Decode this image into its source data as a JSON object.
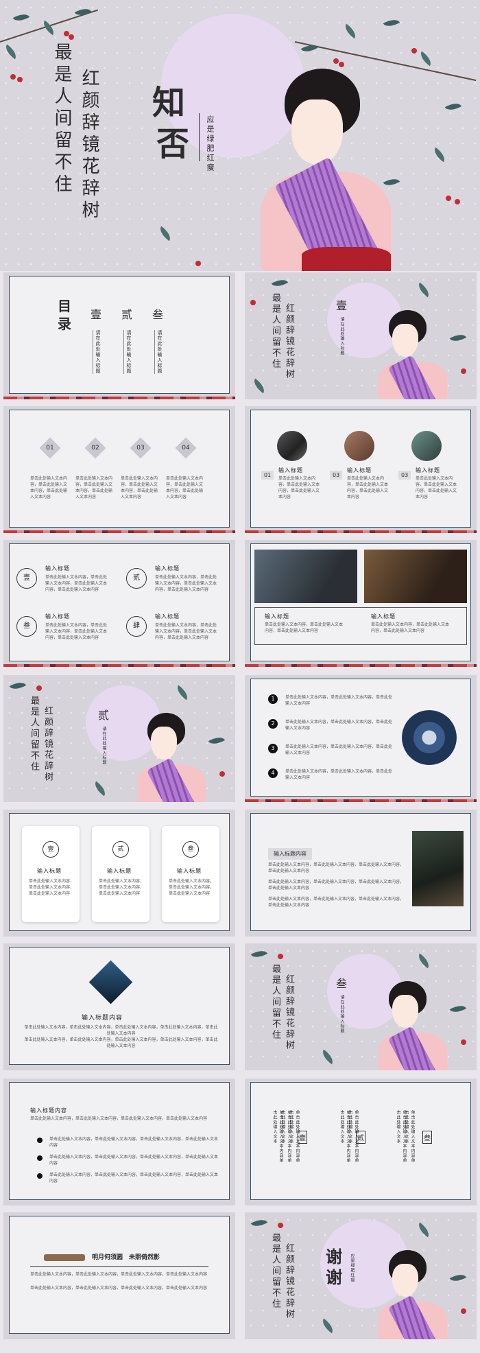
{
  "hero": {
    "title_1": "知",
    "title_2": "否",
    "subtitle": "应是绿肥红瘦",
    "poem_left": "最是人间留不住",
    "poem_right": "红颜辞镜花辞树"
  },
  "toc": {
    "title": "目录",
    "items": [
      {
        "num": "壹",
        "desc": "请在此处输入标题"
      },
      {
        "num": "贰",
        "desc": "请在此处输入标题"
      },
      {
        "num": "叁",
        "desc": "请在此处输入标题"
      }
    ]
  },
  "section1": {
    "num": "壹",
    "desc": "请在此处输入标题"
  },
  "section2": {
    "num": "贰",
    "desc": "请在此处输入标题"
  },
  "section3": {
    "num": "叁",
    "desc": "请在此处输入标题"
  },
  "numbers_slide": {
    "items": [
      "01",
      "02",
      "03",
      "04"
    ],
    "text": "单击此处输入文本内容，单击此处输入文本内容，单击此处输入文本内容"
  },
  "photo_circles": {
    "items": [
      {
        "num": "01",
        "title": "输入标题"
      },
      {
        "num": "03",
        "title": "输入标题"
      },
      {
        "num": "03",
        "title": "输入标题"
      }
    ],
    "text": "单击此处输入文本内容，单击此处输入文本内容，单击此处输入文本内容"
  },
  "four_circles": {
    "items": [
      {
        "num": "壹",
        "title": "输入标题"
      },
      {
        "num": "贰",
        "title": "输入标题"
      },
      {
        "num": "叁",
        "title": "输入标题"
      },
      {
        "num": "肆",
        "title": "输入标题"
      }
    ],
    "text": "单击此处输入文本内容，单击此处输入文本内容，单击此处输入文本内容，单击此处输入文本内容"
  },
  "two_photos": {
    "titles": [
      "输入标题",
      "输入标题"
    ],
    "text": "单击此处输入文本内容，单击此处输入文本内容，单击此处输入文本内容"
  },
  "list_slide": {
    "items": [
      "1",
      "2",
      "3",
      "4"
    ],
    "text": "单击此处输入文本内容，单击此处输入文本内容，单击此处输入文本内容"
  },
  "white_cards": {
    "items": [
      {
        "num": "壹",
        "title": "输入标题"
      },
      {
        "num": "贰",
        "title": "输入标题"
      },
      {
        "num": "叁",
        "title": "输入标题"
      }
    ],
    "text": "单击此处输入文本内容，单击此处输入文本内容，单击此处输入文本内容"
  },
  "content_photo": {
    "title": "输入标题内容",
    "text": "单击此处输入文本内容，单击此处输入文本内容，单击此处输入文本内容，单击此处输入文本内容"
  },
  "diamond_slide": {
    "title": "输入标题内容",
    "text": "单击此处输入文本内容，单击此处输入文本内容，单击此处输入文本内容，单击此处输入文本内容，单击此处输入文本内容"
  },
  "bullet_slide": {
    "title": "输入标题内容",
    "text": "单击此处输入文本内容，单击此处输入文本内容，单击此处输入文本内容，单击此处输入文本内容"
  },
  "vertical_slide": {
    "nums": [
      "壹",
      "贰",
      "叁"
    ],
    "text": "单击此处输入文本内容单击此处输入文本"
  },
  "closing_text": {
    "title": "明月何须圆　未照倚然影",
    "text": "单击此处输入文本内容，单击此处输入文本内容，单击此处输入文本内容，单击此处输入文本内容"
  },
  "thanks": {
    "title_1": "谢",
    "title_2": "谢",
    "subtitle": "应是绿肥红瘦"
  },
  "colors": {
    "accent_dark": "#3d5566",
    "berry": "#c22c3a",
    "moon": "#e6d9f0"
  }
}
